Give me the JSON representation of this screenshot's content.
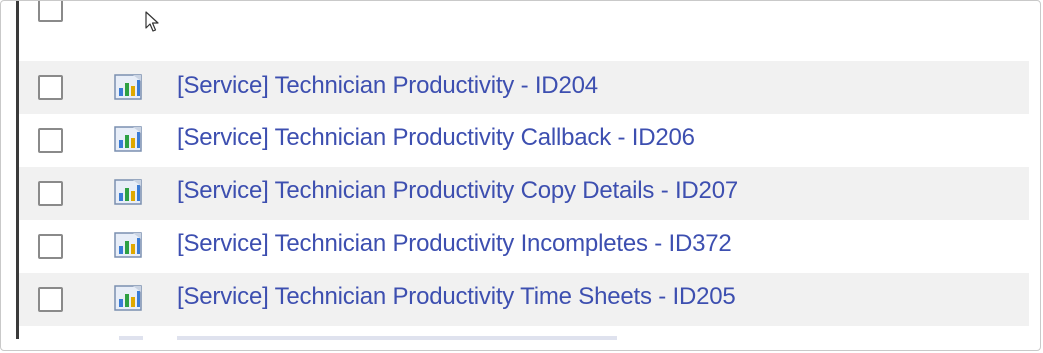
{
  "reports": [
    {
      "title": "[Service] Technician Productivity - ID204"
    },
    {
      "title": "[Service] Technician Productivity Callback - ID206"
    },
    {
      "title": "[Service] Technician Productivity Copy Details - ID207"
    },
    {
      "title": "[Service] Technician Productivity Incompletes - ID372"
    },
    {
      "title": "[Service] Technician Productivity Time Sheets - ID205"
    }
  ],
  "icons": {
    "report": "report-chart-icon",
    "cursor": "mouse-pointer-icon"
  },
  "colors": {
    "link": "#3d4fb0",
    "row_shade": "#f1f1f1",
    "checkbox_border": "#8a8a8a"
  }
}
